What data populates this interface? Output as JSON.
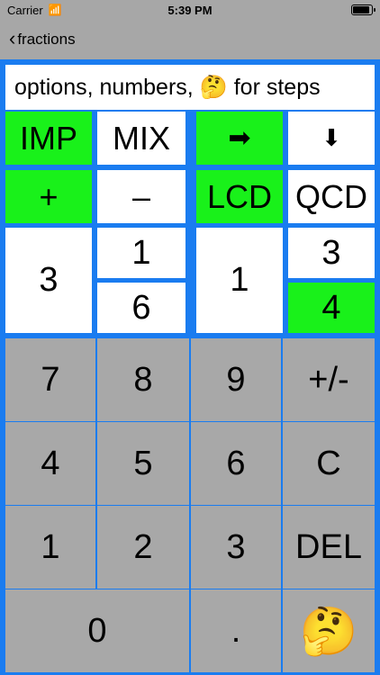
{
  "status": {
    "carrier": "Carrier",
    "time": "5:39 PM",
    "wifi_icon": "wifi-icon",
    "battery_icon": "battery-icon"
  },
  "nav": {
    "back_label": "fractions"
  },
  "message": "options, numbers, 🤔 for steps",
  "options": {
    "imp": "IMP",
    "mix": "MIX",
    "arrow_right": "➡",
    "arrow_down": "⬇",
    "plus": "+",
    "minus": "–",
    "lcd": "LCD",
    "qcd": "QCD"
  },
  "fraction1": {
    "whole": "3",
    "numerator": "1",
    "denominator": "6"
  },
  "fraction2": {
    "whole": "1",
    "numerator": "3",
    "denominator": "4"
  },
  "keypad": {
    "k7": "7",
    "k8": "8",
    "k9": "9",
    "sign": "+/-",
    "k4": "4",
    "k5": "5",
    "k6": "6",
    "clear": "C",
    "k1": "1",
    "k2": "2",
    "k3": "3",
    "del": "DEL",
    "k0": "0",
    "dot": ".",
    "think": "🤔"
  },
  "colors": {
    "accent": "#1a7cf0",
    "green": "#19f11a",
    "key": "#a8a8a8"
  }
}
